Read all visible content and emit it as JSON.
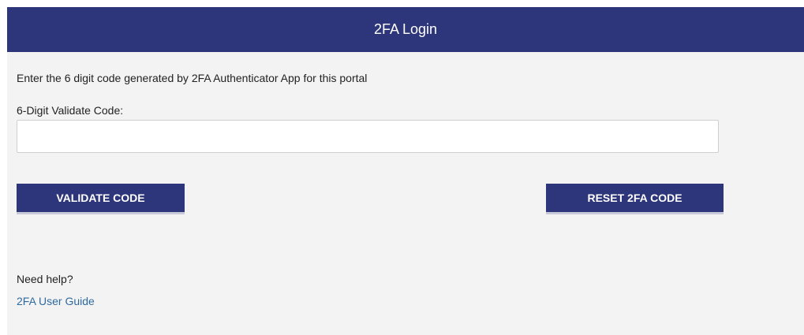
{
  "header": {
    "title": "2FA Login"
  },
  "form": {
    "instruction": "Enter the 6 digit code generated by 2FA Authenticator App for this portal",
    "code_label": "6-Digit Validate Code:",
    "code_value": "",
    "validate_label": "VALIDATE CODE",
    "reset_label": "RESET 2FA CODE"
  },
  "help": {
    "text": "Need help?",
    "link_label": "2FA User Guide"
  },
  "colors": {
    "header_bg": "#2e367b",
    "button_bg": "#2e367b",
    "link": "#2f6a9e",
    "panel_bg": "#f3f3f3"
  }
}
